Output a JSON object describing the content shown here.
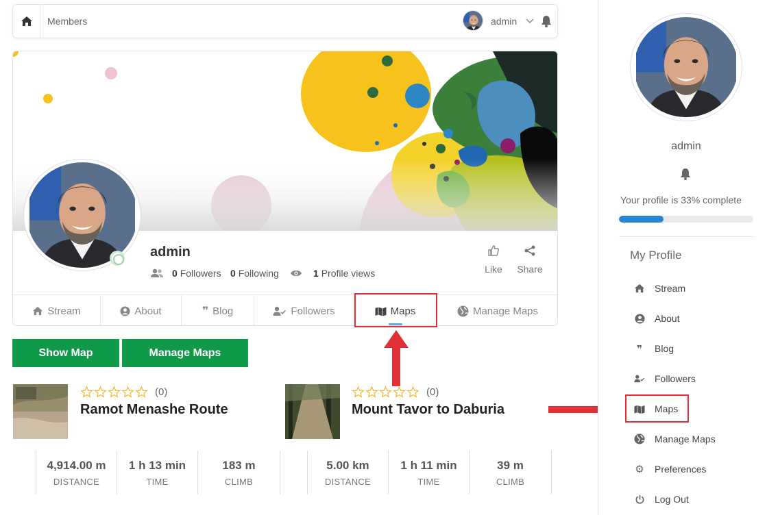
{
  "topbar": {
    "breadcrumb": "Members",
    "username": "admin"
  },
  "profile": {
    "name": "admin",
    "followers_count": "0",
    "followers_label": "Followers",
    "following_count": "0",
    "following_label": "Following",
    "views_count": "1",
    "views_label": "Profile views",
    "like_label": "Like",
    "share_label": "Share"
  },
  "tabs": [
    {
      "label": "Stream",
      "icon": "home-icon"
    },
    {
      "label": "About",
      "icon": "user-circle-icon"
    },
    {
      "label": "Blog",
      "icon": "quote-icon"
    },
    {
      "label": "Followers",
      "icon": "user-check-icon"
    },
    {
      "label": "Maps",
      "icon": "map-icon",
      "active": true
    },
    {
      "label": "Manage Maps",
      "icon": "globe-icon"
    }
  ],
  "buttons": {
    "show_map": "Show Map",
    "manage_maps": "Manage Maps"
  },
  "routes": [
    {
      "name": "Ramot Menashe Route",
      "rating": "(0)",
      "distance": "4,914.00 m",
      "time": "1 h 13 min",
      "climb": "183 m"
    },
    {
      "name": "Mount Tavor to Daburia",
      "rating": "(0)",
      "distance": "5.00 km",
      "time": "1 h 11 min",
      "climb": "39 m"
    }
  ],
  "route_labels": {
    "distance": "DISTANCE",
    "time": "TIME",
    "climb": "CLIMB"
  },
  "sidebar": {
    "name": "admin",
    "completion_text": "Your profile is 33% complete",
    "completion": 0.33,
    "section_title": "My Profile",
    "items": [
      {
        "label": "Stream",
        "icon": "home-icon"
      },
      {
        "label": "About",
        "icon": "user-circle-icon"
      },
      {
        "label": "Blog",
        "icon": "quote-icon"
      },
      {
        "label": "Followers",
        "icon": "user-check-icon"
      },
      {
        "label": "Maps",
        "icon": "map-icon"
      },
      {
        "label": "Manage Maps",
        "icon": "globe-icon"
      },
      {
        "label": "Preferences",
        "icon": "gear-icon"
      },
      {
        "label": "Log Out",
        "icon": "power-icon"
      }
    ]
  },
  "colors": {
    "accent_green": "#0f9a47",
    "highlight_red": "#e03137",
    "progress_blue": "#2585d6"
  }
}
